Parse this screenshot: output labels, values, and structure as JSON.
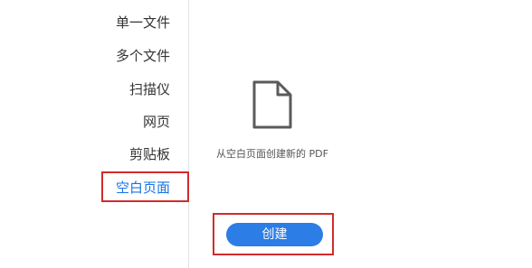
{
  "sidebar": {
    "items": [
      {
        "label": "单一文件"
      },
      {
        "label": "多个文件"
      },
      {
        "label": "扫描仪"
      },
      {
        "label": "网页"
      },
      {
        "label": "剪贴板"
      },
      {
        "label": "空白页面",
        "selected": true
      }
    ]
  },
  "main": {
    "icon": "document-icon",
    "description": "从空白页面创建新的 PDF",
    "create_label": "创建"
  },
  "colors": {
    "accent": "#1473e6",
    "button": "#2d7de6",
    "annotation": "#d22b2b"
  }
}
